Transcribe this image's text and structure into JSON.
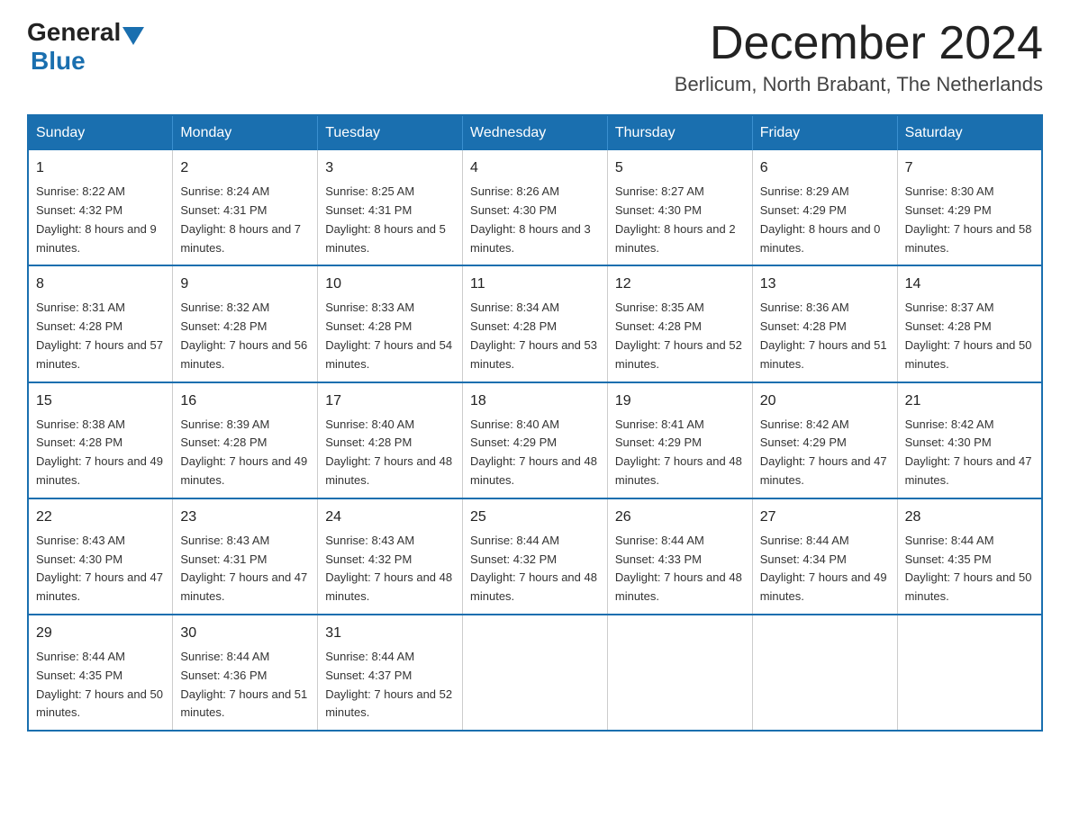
{
  "header": {
    "logo_general": "General",
    "logo_blue": "Blue",
    "month_title": "December 2024",
    "location": "Berlicum, North Brabant, The Netherlands"
  },
  "weekdays": [
    "Sunday",
    "Monday",
    "Tuesday",
    "Wednesday",
    "Thursday",
    "Friday",
    "Saturday"
  ],
  "weeks": [
    [
      {
        "day": "1",
        "sunrise": "8:22 AM",
        "sunset": "4:32 PM",
        "daylight": "8 hours and 9 minutes."
      },
      {
        "day": "2",
        "sunrise": "8:24 AM",
        "sunset": "4:31 PM",
        "daylight": "8 hours and 7 minutes."
      },
      {
        "day": "3",
        "sunrise": "8:25 AM",
        "sunset": "4:31 PM",
        "daylight": "8 hours and 5 minutes."
      },
      {
        "day": "4",
        "sunrise": "8:26 AM",
        "sunset": "4:30 PM",
        "daylight": "8 hours and 3 minutes."
      },
      {
        "day": "5",
        "sunrise": "8:27 AM",
        "sunset": "4:30 PM",
        "daylight": "8 hours and 2 minutes."
      },
      {
        "day": "6",
        "sunrise": "8:29 AM",
        "sunset": "4:29 PM",
        "daylight": "8 hours and 0 minutes."
      },
      {
        "day": "7",
        "sunrise": "8:30 AM",
        "sunset": "4:29 PM",
        "daylight": "7 hours and 58 minutes."
      }
    ],
    [
      {
        "day": "8",
        "sunrise": "8:31 AM",
        "sunset": "4:28 PM",
        "daylight": "7 hours and 57 minutes."
      },
      {
        "day": "9",
        "sunrise": "8:32 AM",
        "sunset": "4:28 PM",
        "daylight": "7 hours and 56 minutes."
      },
      {
        "day": "10",
        "sunrise": "8:33 AM",
        "sunset": "4:28 PM",
        "daylight": "7 hours and 54 minutes."
      },
      {
        "day": "11",
        "sunrise": "8:34 AM",
        "sunset": "4:28 PM",
        "daylight": "7 hours and 53 minutes."
      },
      {
        "day": "12",
        "sunrise": "8:35 AM",
        "sunset": "4:28 PM",
        "daylight": "7 hours and 52 minutes."
      },
      {
        "day": "13",
        "sunrise": "8:36 AM",
        "sunset": "4:28 PM",
        "daylight": "7 hours and 51 minutes."
      },
      {
        "day": "14",
        "sunrise": "8:37 AM",
        "sunset": "4:28 PM",
        "daylight": "7 hours and 50 minutes."
      }
    ],
    [
      {
        "day": "15",
        "sunrise": "8:38 AM",
        "sunset": "4:28 PM",
        "daylight": "7 hours and 49 minutes."
      },
      {
        "day": "16",
        "sunrise": "8:39 AM",
        "sunset": "4:28 PM",
        "daylight": "7 hours and 49 minutes."
      },
      {
        "day": "17",
        "sunrise": "8:40 AM",
        "sunset": "4:28 PM",
        "daylight": "7 hours and 48 minutes."
      },
      {
        "day": "18",
        "sunrise": "8:40 AM",
        "sunset": "4:29 PM",
        "daylight": "7 hours and 48 minutes."
      },
      {
        "day": "19",
        "sunrise": "8:41 AM",
        "sunset": "4:29 PM",
        "daylight": "7 hours and 48 minutes."
      },
      {
        "day": "20",
        "sunrise": "8:42 AM",
        "sunset": "4:29 PM",
        "daylight": "7 hours and 47 minutes."
      },
      {
        "day": "21",
        "sunrise": "8:42 AM",
        "sunset": "4:30 PM",
        "daylight": "7 hours and 47 minutes."
      }
    ],
    [
      {
        "day": "22",
        "sunrise": "8:43 AM",
        "sunset": "4:30 PM",
        "daylight": "7 hours and 47 minutes."
      },
      {
        "day": "23",
        "sunrise": "8:43 AM",
        "sunset": "4:31 PM",
        "daylight": "7 hours and 47 minutes."
      },
      {
        "day": "24",
        "sunrise": "8:43 AM",
        "sunset": "4:32 PM",
        "daylight": "7 hours and 48 minutes."
      },
      {
        "day": "25",
        "sunrise": "8:44 AM",
        "sunset": "4:32 PM",
        "daylight": "7 hours and 48 minutes."
      },
      {
        "day": "26",
        "sunrise": "8:44 AM",
        "sunset": "4:33 PM",
        "daylight": "7 hours and 48 minutes."
      },
      {
        "day": "27",
        "sunrise": "8:44 AM",
        "sunset": "4:34 PM",
        "daylight": "7 hours and 49 minutes."
      },
      {
        "day": "28",
        "sunrise": "8:44 AM",
        "sunset": "4:35 PM",
        "daylight": "7 hours and 50 minutes."
      }
    ],
    [
      {
        "day": "29",
        "sunrise": "8:44 AM",
        "sunset": "4:35 PM",
        "daylight": "7 hours and 50 minutes."
      },
      {
        "day": "30",
        "sunrise": "8:44 AM",
        "sunset": "4:36 PM",
        "daylight": "7 hours and 51 minutes."
      },
      {
        "day": "31",
        "sunrise": "8:44 AM",
        "sunset": "4:37 PM",
        "daylight": "7 hours and 52 minutes."
      },
      null,
      null,
      null,
      null
    ]
  ]
}
